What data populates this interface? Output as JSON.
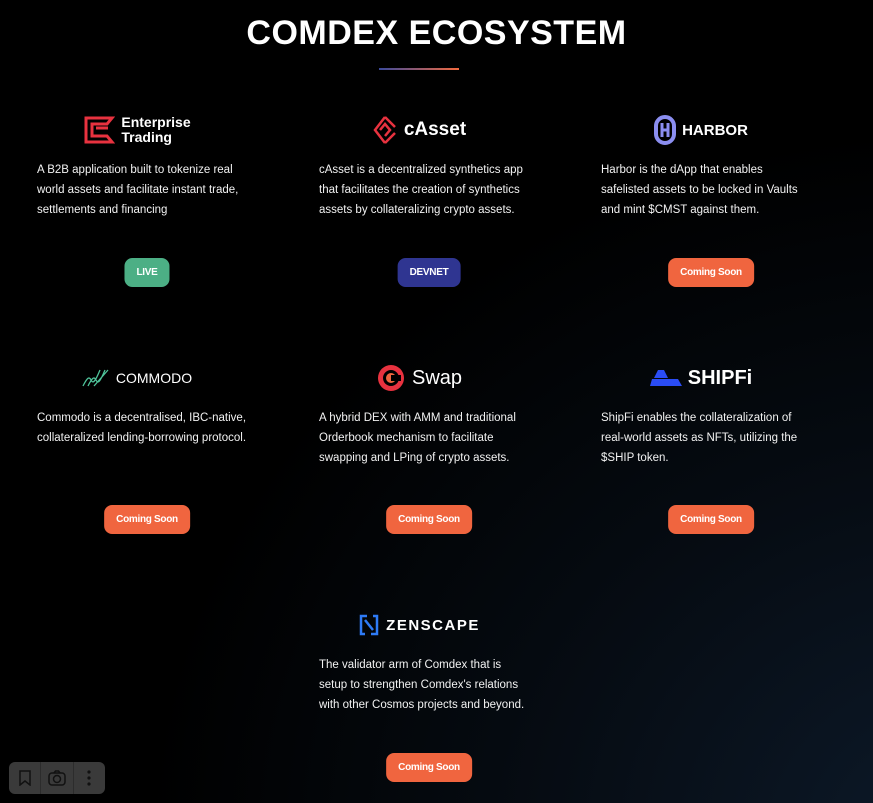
{
  "title": "COMDEX ECOSYSTEM",
  "colors": {
    "live": "#4caf85",
    "devnet": "#2f3591",
    "coming_soon": "#f0653f",
    "underline_start": "#3b4a9c",
    "underline_end": "#f26a3f"
  },
  "cards": [
    {
      "name": "Enterprise Trading",
      "logo_line1": "Enterprise",
      "logo_line2": "Trading",
      "desc": "A B2B application built to tokenize real world assets and facilitate instant trade, settlements and financing",
      "status": "LIVE"
    },
    {
      "name": "cAsset",
      "logo": "cAsset",
      "desc": "cAsset is a decentralized synthetics app that facilitates the creation of synthetics assets by collateralizing crypto assets.",
      "status": "DEVNET"
    },
    {
      "name": "Harbor",
      "logo": "HARBOR",
      "desc": "Harbor is the dApp that enables safelisted assets to be locked in Vaults and mint $CMST against them.",
      "status": "Coming Soon"
    },
    {
      "name": "Commodo",
      "logo": "COMMODO",
      "desc": "Commodo is a decentralised, IBC-native, collateralized lending-borrowing protocol.",
      "status": "Coming Soon"
    },
    {
      "name": "cSwap",
      "logo": "Swap",
      "desc": "A hybrid DEX with AMM and traditional Orderbook mechanism to facilitate swapping and LPing of crypto assets.",
      "status": "Coming Soon"
    },
    {
      "name": "ShipFi",
      "logo": "SHIPFi",
      "desc": "ShipFi enables the collateralization of real-world assets as NFTs, utilizing the $SHIP token.",
      "status": "Coming Soon"
    },
    {
      "name": "Zenscape",
      "logo": "ZENSCAPE",
      "desc": "The validator arm of Comdex that is setup to strengthen Comdex's relations with other Cosmos projects and beyond.",
      "status": "Coming Soon"
    }
  ]
}
